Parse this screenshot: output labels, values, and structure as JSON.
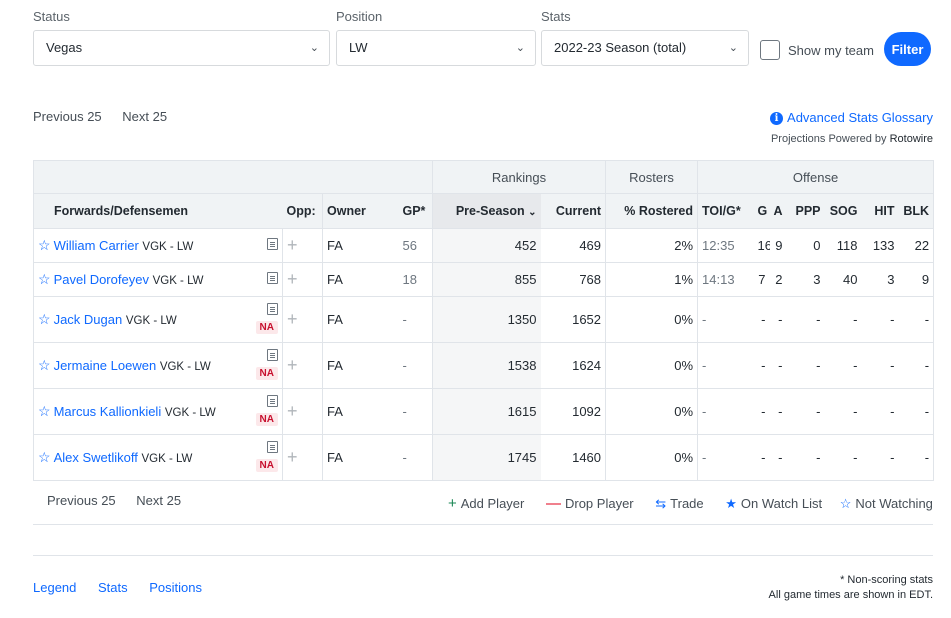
{
  "filters": {
    "status_label": "Status",
    "status_value": "Vegas",
    "position_label": "Position",
    "position_value": "LW",
    "stats_label": "Stats",
    "stats_value": "2022-23 Season (total)",
    "show_my_team_label": "Show my team",
    "filter_button": "Filter"
  },
  "pager": {
    "previous": "Previous 25",
    "next": "Next 25"
  },
  "glossary": {
    "info_glyph": "i",
    "link": "Advanced Stats Glossary",
    "projections_prefix": "Projections Powered by",
    "projections_brand": "Rotowire"
  },
  "table": {
    "group_headers": {
      "rankings": "Rankings",
      "rosters": "Rosters",
      "offense": "Offense"
    },
    "columns": {
      "player": "Forwards/Defensemen",
      "opp": "Opp:",
      "owner": "Owner",
      "gp": "GP*",
      "pre_season": "Pre-Season",
      "current": "Current",
      "rostered": "% Rostered",
      "toi": "TOI/G*",
      "g": "G",
      "a": "A",
      "ppp": "PPP",
      "sog": "SOG",
      "hit": "HIT",
      "blk": "BLK"
    },
    "rows": [
      {
        "name": "William Carrier",
        "team": "VGK - LW",
        "na": "",
        "opp": "",
        "owner": "FA",
        "gp": "56",
        "pre": "452",
        "cur": "469",
        "rost": "2%",
        "toi": "12:35",
        "g": "16",
        "a": "9",
        "ppp": "0",
        "sog": "118",
        "hit": "133",
        "blk": "22"
      },
      {
        "name": "Pavel Dorofeyev",
        "team": "VGK - LW",
        "na": "",
        "opp": "",
        "owner": "FA",
        "gp": "18",
        "pre": "855",
        "cur": "768",
        "rost": "1%",
        "toi": "14:13",
        "g": "7",
        "a": "2",
        "ppp": "3",
        "sog": "40",
        "hit": "3",
        "blk": "9"
      },
      {
        "name": "Jack Dugan",
        "team": "VGK - LW",
        "na": "NA",
        "opp": "",
        "owner": "FA",
        "gp": "-",
        "pre": "1350",
        "cur": "1652",
        "rost": "0%",
        "toi": "-",
        "g": "-",
        "a": "-",
        "ppp": "-",
        "sog": "-",
        "hit": "-",
        "blk": "-"
      },
      {
        "name": "Jermaine Loewen",
        "team": "VGK - LW",
        "na": "NA",
        "opp": "",
        "owner": "FA",
        "gp": "-",
        "pre": "1538",
        "cur": "1624",
        "rost": "0%",
        "toi": "-",
        "g": "-",
        "a": "-",
        "ppp": "-",
        "sog": "-",
        "hit": "-",
        "blk": "-"
      },
      {
        "name": "Marcus Kallionkieli",
        "team": "VGK - LW",
        "na": "NA",
        "opp": "",
        "owner": "FA",
        "gp": "-",
        "pre": "1615",
        "cur": "1092",
        "rost": "0%",
        "toi": "-",
        "g": "-",
        "a": "-",
        "ppp": "-",
        "sog": "-",
        "hit": "-",
        "blk": "-"
      },
      {
        "name": "Alex Swetlikoff",
        "team": "VGK - LW",
        "na": "NA",
        "opp": "",
        "owner": "FA",
        "gp": "-",
        "pre": "1745",
        "cur": "1460",
        "rost": "0%",
        "toi": "-",
        "g": "-",
        "a": "-",
        "ppp": "-",
        "sog": "-",
        "hit": "-",
        "blk": "-"
      }
    ]
  },
  "legend": {
    "add_player": "Add Player",
    "drop_player": "Drop Player",
    "trade": "Trade",
    "on_watch_list": "On Watch List",
    "not_watching": "Not Watching"
  },
  "footer": {
    "links": [
      "Legend",
      "Stats",
      "Positions"
    ],
    "non_scoring": "* Non-scoring stats",
    "edt": "All game times are shown in EDT."
  },
  "colors": {
    "accent": "#0f69ff",
    "na_red": "#c7102e",
    "drop_red": "#e0001b",
    "add_green": "#1a8754"
  }
}
